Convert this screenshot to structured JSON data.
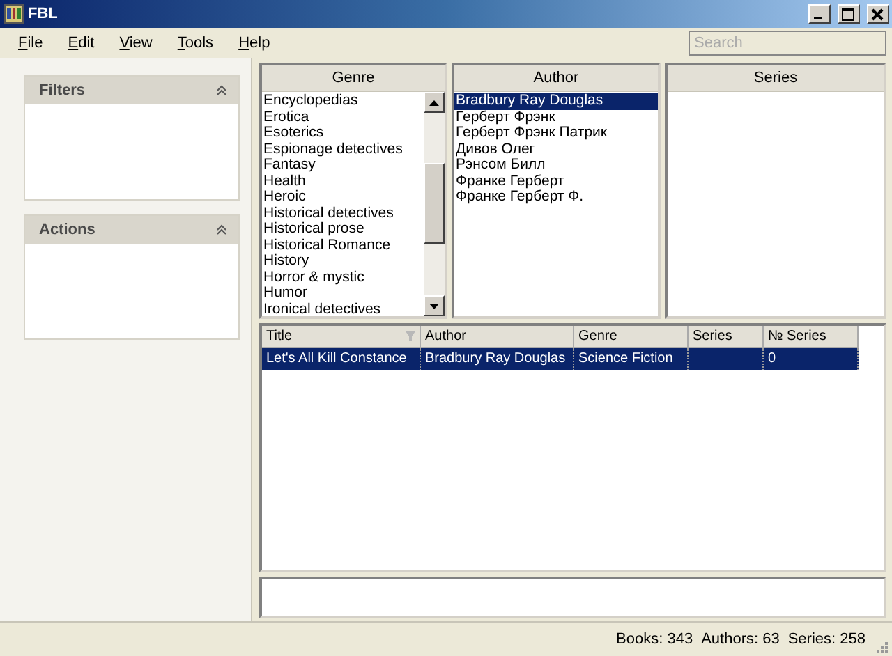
{
  "window": {
    "title": "FBL"
  },
  "menu": [
    {
      "label": "File"
    },
    {
      "label": "Edit"
    },
    {
      "label": "View"
    },
    {
      "label": "Tools"
    },
    {
      "label": "Help"
    }
  ],
  "search": {
    "placeholder": "Search"
  },
  "side_panels": [
    {
      "title": "Filters",
      "expanded": true
    },
    {
      "title": "Actions",
      "expanded": true
    }
  ],
  "lists": [
    {
      "header": "Genre",
      "scrollbar": true,
      "items": [
        {
          "label": "Encyclopedias",
          "selected": false
        },
        {
          "label": "Erotica",
          "selected": false
        },
        {
          "label": "Esoterics",
          "selected": false
        },
        {
          "label": "Espionage detectives",
          "selected": false
        },
        {
          "label": "Fantasy",
          "selected": false
        },
        {
          "label": "Health",
          "selected": false
        },
        {
          "label": "Heroic",
          "selected": false
        },
        {
          "label": "Historical detectives",
          "selected": false
        },
        {
          "label": "Historical prose",
          "selected": false
        },
        {
          "label": "Historical Romance",
          "selected": false
        },
        {
          "label": "History",
          "selected": false
        },
        {
          "label": "Horror & mystic",
          "selected": false
        },
        {
          "label": "Humor",
          "selected": false
        },
        {
          "label": "Ironical detectives",
          "selected": false
        }
      ]
    },
    {
      "header": "Author",
      "scrollbar": false,
      "items": [
        {
          "label": "Bradbury Ray Douglas",
          "selected": true
        },
        {
          "label": "Герберт Фрэнк",
          "selected": false
        },
        {
          "label": "Герберт Фрэнк Патрик",
          "selected": false
        },
        {
          "label": "Дивов Олег",
          "selected": false
        },
        {
          "label": "Рэнсом Билл",
          "selected": false
        },
        {
          "label": "Франке Герберт",
          "selected": false
        },
        {
          "label": "Франке Герберт Ф.",
          "selected": false
        }
      ]
    },
    {
      "header": "Series",
      "scrollbar": false
    }
  ],
  "table": {
    "columns": [
      {
        "label": "Title",
        "sort": true
      },
      {
        "label": "Author",
        "sort": false
      },
      {
        "label": "Genre",
        "sort": false
      },
      {
        "label": "Series",
        "sort": false
      },
      {
        "label": "№ Series",
        "sort": false
      }
    ],
    "rows": [
      {
        "cells": [
          "Let's All Kill Constance",
          "Bradbury Ray Douglas",
          "Science Fiction",
          "",
          "0"
        ],
        "selected": true
      }
    ]
  },
  "status_bar": {
    "books": "Books: 343",
    "authors": "Authors: 63",
    "series": "Series: 258"
  }
}
